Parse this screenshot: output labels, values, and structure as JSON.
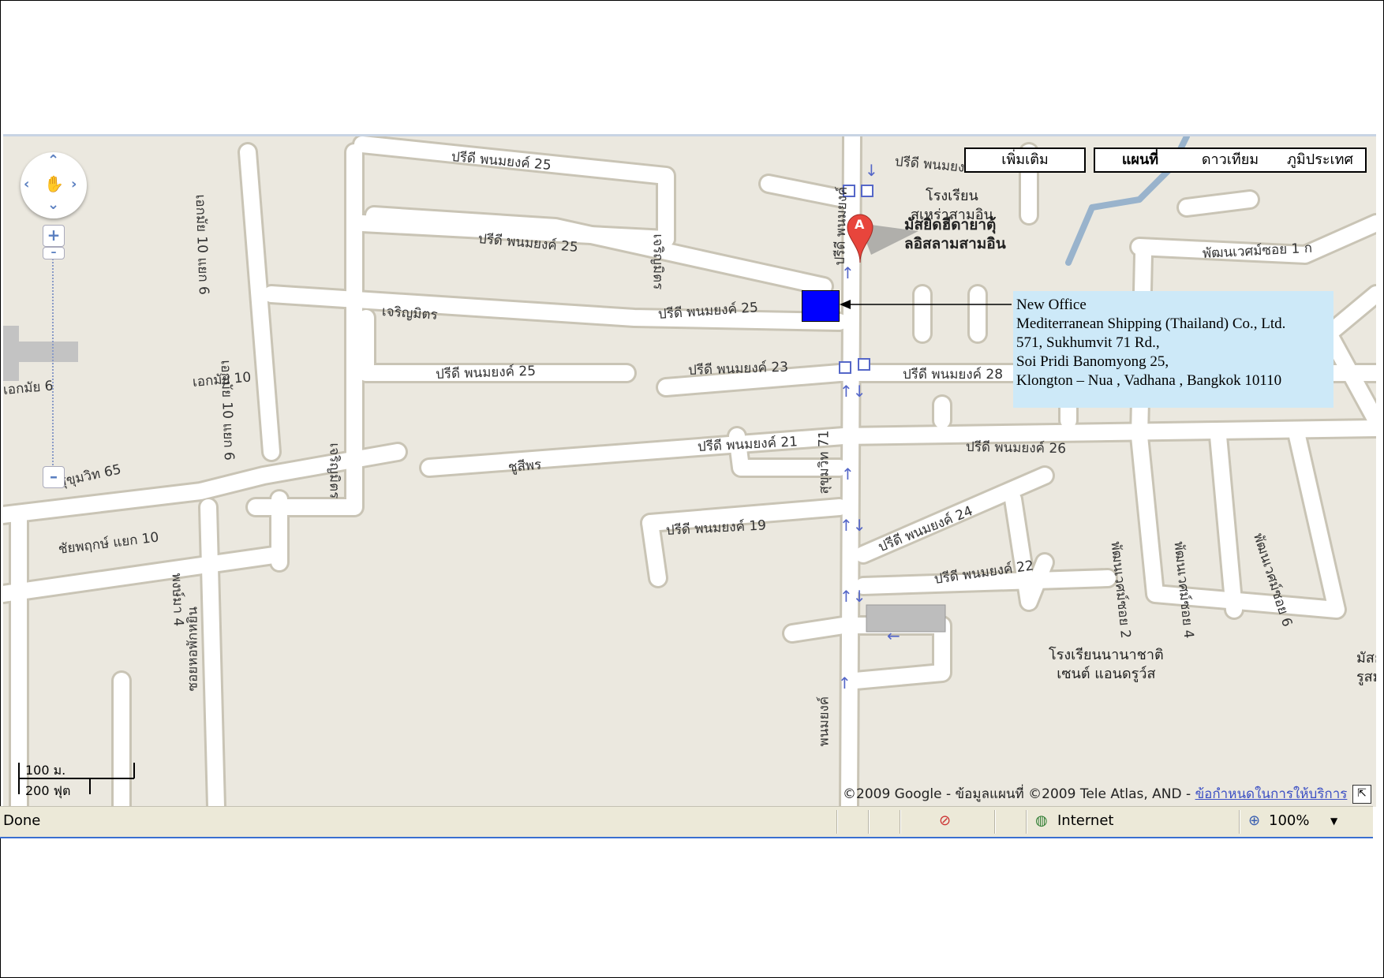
{
  "map_types": {
    "more": "เพิ่มเติม",
    "map": "แผนที่",
    "satellite": "ดาวเทียม",
    "terrain": "ภูมิประเทศ"
  },
  "road_labels": [
    "ปรีดี พนมยงค์ 25",
    "ปรีดี พนมยงค์ 25",
    "ปรีดี พนมยงค์ 25",
    "ปรีดี พนมยงค์ 25",
    "ปรีดี พนมยงค์ 23",
    "ปรีดี พนมยงค์ 28",
    "ปรีดี พนมยงค์ 21",
    "ปรีดี พนมยงค์ 26",
    "ปรีดี พนมยงค์ 19",
    "ปรีดี พนมยงค์ 24",
    "ปรีดี พนมยงค์ 22",
    "เจริญมิตร",
    "เจริญมิตร",
    "เจริญมิตร",
    "ชูสีพร",
    "สุขุมวิท 65",
    "สุขุมวิท 71",
    "เอกมัย 10",
    "เอกมัย 10 แยก 6",
    "เอกมัย 10 แยก 6",
    "เอกมัย 6",
    "ชัยพฤกษ์ แยก 10",
    "พัฒนเวศม์ซอย 1 ก",
    "พัฒนเวศม์ซอย 2",
    "พัฒนเวศม์ซอย 4",
    "พัฒนเวศม์ซอย 6",
    "พงษ์มา 4",
    "ซอยหอพักหยิน",
    "พนมยงค์",
    "ปรีดี พนมยงค์",
    "ปรีดี พนมยงค์"
  ],
  "pois": {
    "school1": [
      "โรงเรียน",
      "สุเหร่าสามอิน"
    ],
    "mosque": [
      "มัสยิดฮีดายาตุ้",
      "ลอิสลามสามอิน"
    ],
    "school2": [
      "โรงเรียนนานาชาติ",
      "เซนต์ แอนดรูว์ส"
    ],
    "edge": [
      "มัสย",
      "รูสม"
    ]
  },
  "marker": {
    "letter": "A"
  },
  "callout": {
    "lines": [
      "New Office",
      "Mediterranean Shipping (Thailand) Co., Ltd.",
      "571, Sukhumvit 71 Rd.,",
      "Soi Pridi Banomyong 25,",
      "Klongton – Nua , Vadhana , Bangkok 10110"
    ]
  },
  "scale": {
    "metric": "100 ม.",
    "imperial": "200 ฟุต"
  },
  "copyright": {
    "text": "©2009 Google - ข้อมูลแผนที่ ©2009 Tele Atlas, AND - ",
    "link": "ข้อกำหนดในการให้บริการ"
  },
  "statusbar": {
    "status": "Done",
    "zone": "Internet",
    "zoom": "100%"
  },
  "icons": [
    "pan-control-icon",
    "zoom-in-icon",
    "zoom-out-icon",
    "map-pin-icon",
    "globe-icon",
    "zoom-icon",
    "popup-blocked-icon",
    "expand-icon",
    "bus-stop-icon"
  ],
  "colors": {
    "map_bg": "#ebe8df",
    "road": "#ffffff",
    "road_edge": "#c9c4b5",
    "water": "#99b3cc",
    "office_marker": "#0000ff",
    "callout_bg": "#cde9f8"
  }
}
